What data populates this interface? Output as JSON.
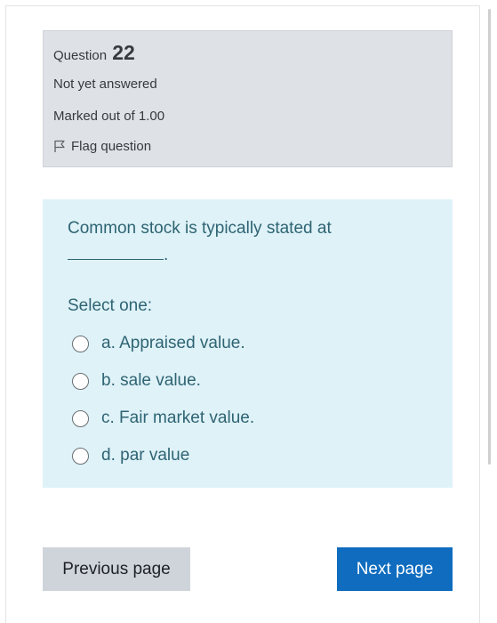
{
  "question": {
    "label": "Question",
    "number": "22",
    "state": "Not yet answered",
    "grade": "Marked out of 1.00",
    "flag_label": "Flag question",
    "flag_icon": "flag-icon"
  },
  "content": {
    "text_part1": "Common stock is typically stated at",
    "text_part2": ".",
    "prompt": "Select one:",
    "answers": [
      {
        "label": "a. Appraised value.",
        "selected": false
      },
      {
        "label": "b. sale value.",
        "selected": false
      },
      {
        "label": "c. Fair market value.",
        "selected": false
      },
      {
        "label": "d. par value",
        "selected": false
      }
    ]
  },
  "navigation": {
    "previous_label": "Previous page",
    "next_label": "Next page"
  },
  "colors": {
    "info_background": "#dee2e6",
    "content_background": "#def2f8",
    "content_text": "#2f6473",
    "next_button": "#0f6cbf",
    "previous_button": "#ced4da"
  }
}
